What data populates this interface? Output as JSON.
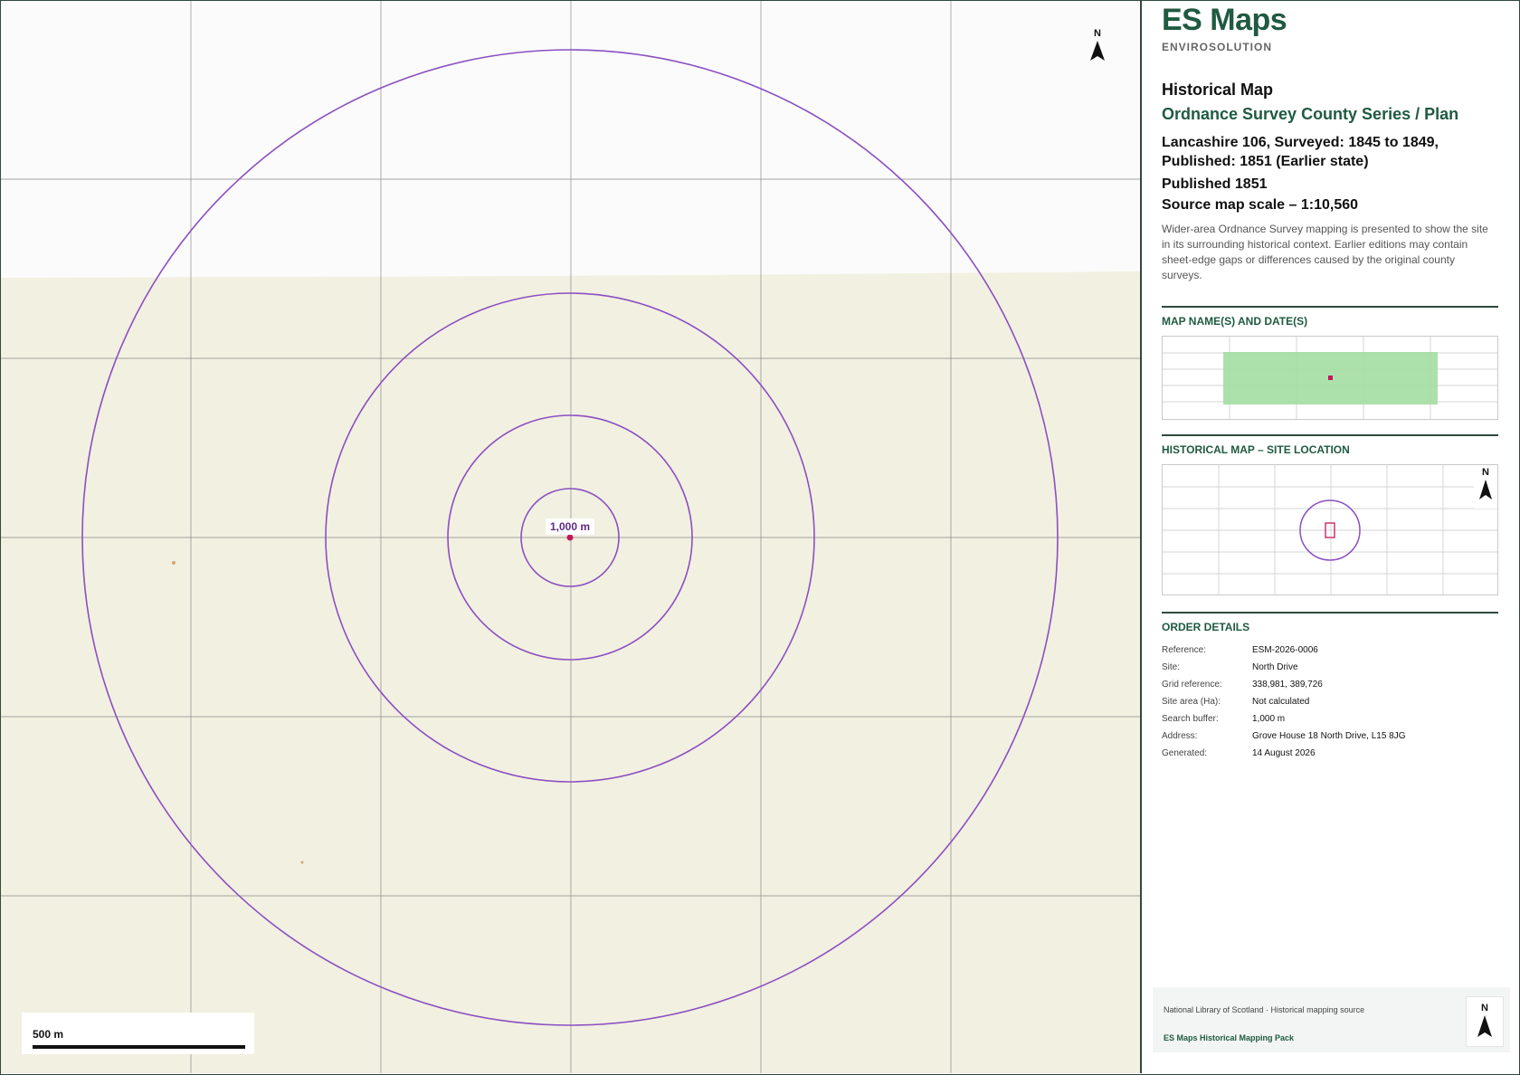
{
  "map": {
    "ring_label": "1,000 m",
    "north_label": "N",
    "scale_label": "500 m",
    "colors": {
      "ring": "#8b4fc2",
      "site": "#c2185b",
      "paper": "#f2f0e1",
      "grid": "#8a8a8a"
    }
  },
  "panel": {
    "brand": "ES Maps",
    "brand_sub": "ENVIROSOLUTION",
    "title": "Historical Map",
    "series": "Ordnance Survey County Series / Plan",
    "sheet": "Lancashire 106, Surveyed: 1845 to 1849, Published: 1851 (Earlier state)",
    "published": "Published 1851",
    "source_scale": "Source map scale – 1:10,560",
    "description": "Wider-area Ordnance Survey mapping is presented to show the site in its surrounding historical context. Earlier editions may contain sheet-edge gaps or differences caused by the original county surveys.",
    "section_names": "MAP NAME(S) AND DATE(S)",
    "section_location": "HISTORICAL MAP – SITE LOCATION",
    "section_order": "ORDER DETAILS",
    "location_north": "N",
    "order": [
      {
        "key": "Reference:",
        "value": "ESM-2026-0006"
      },
      {
        "key": "Site:",
        "value": "North Drive"
      },
      {
        "key": "Grid reference:",
        "value": "338,981, 389,726"
      },
      {
        "key": "Site area (Ha):",
        "value": "Not calculated"
      },
      {
        "key": "Search buffer:",
        "value": "1,000 m"
      },
      {
        "key": "Address:",
        "value": "Grove House 18 North Drive, L15 8JG"
      },
      {
        "key": "Generated:",
        "value": "14 August 2026"
      }
    ],
    "footer": {
      "source": "National Library of Scotland · Historical mapping source",
      "pack": "ES Maps Historical Mapping Pack",
      "north": "N"
    },
    "colors": {
      "brand": "#1f5a41",
      "coverage": "#a3dea3"
    }
  }
}
